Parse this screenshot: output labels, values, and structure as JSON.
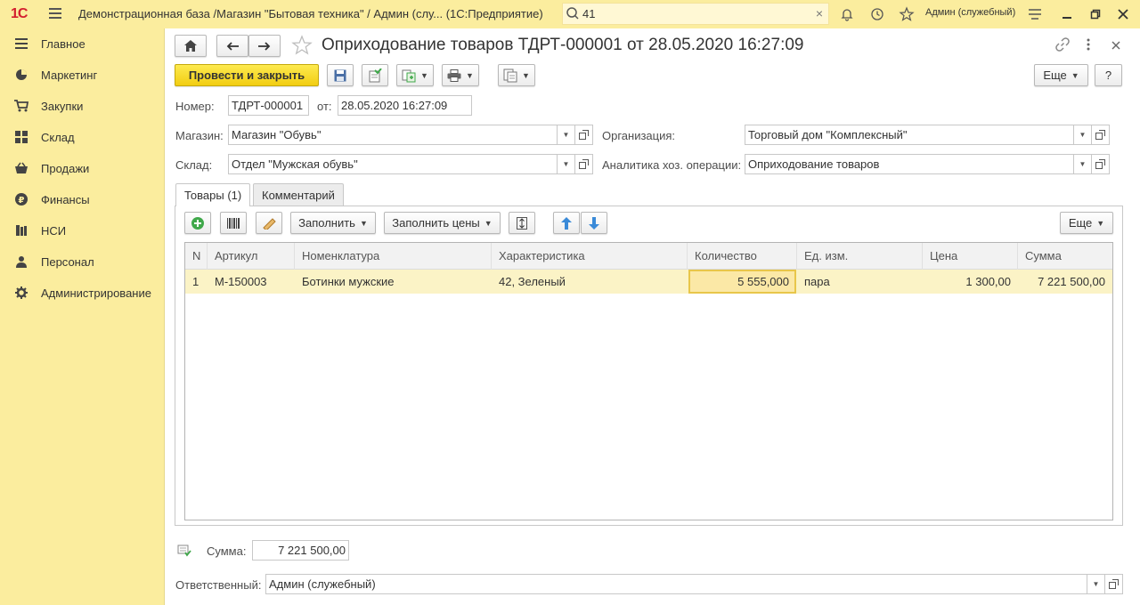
{
  "titlebar": {
    "logo_text": "1С",
    "app_title": "Демонстрационная база /Магазин \"Бытовая техника\" / Админ (слу...  (1С:Предприятие)",
    "search_value": "41",
    "user_name": "Админ (служебный)",
    "icons": [
      "menu-icon",
      "search-icon",
      "clear-icon",
      "bell-icon",
      "history-icon",
      "star-icon",
      "settings-icon",
      "minimize-icon",
      "restore-icon",
      "close-icon"
    ]
  },
  "sidebar": {
    "items": [
      {
        "label": "Главное",
        "icon": "menu-lines-icon"
      },
      {
        "label": "Маркетинг",
        "icon": "pie-chart-icon"
      },
      {
        "label": "Закупки",
        "icon": "cart-icon"
      },
      {
        "label": "Склад",
        "icon": "warehouse-icon"
      },
      {
        "label": "Продажи",
        "icon": "basket-icon"
      },
      {
        "label": "Финансы",
        "icon": "ruble-icon"
      },
      {
        "label": "НСИ",
        "icon": "books-icon"
      },
      {
        "label": "Персонал",
        "icon": "person-icon"
      },
      {
        "label": "Администрирование",
        "icon": "gear-icon"
      }
    ]
  },
  "document": {
    "title": "Оприходование товаров ТДРТ-000001 от 28.05.2020 16:27:09",
    "post_and_close_label": "Провести и закрыть",
    "more_label": "Еще",
    "help_label": "?",
    "number_label": "Номер:",
    "number_value": "ТДРТ-000001",
    "date_label": "от:",
    "date_value": "28.05.2020 16:27:09",
    "store_label": "Магазин:",
    "store_value": "Магазин \"Обувь\"",
    "warehouse_label": "Склад:",
    "warehouse_value": "Отдел \"Мужская обувь\"",
    "org_label": "Организация:",
    "org_value": "Торговый дом \"Комплексный\"",
    "analytics_label": "Аналитика хоз. операции:",
    "analytics_value": "Оприходование товаров"
  },
  "tabs": [
    {
      "label": "Товары (1)",
      "active": true
    },
    {
      "label": "Комментарий",
      "active": false
    }
  ],
  "goods_toolbar": {
    "fill_label": "Заполнить",
    "fill_prices_label": "Заполнить цены",
    "more_label": "Еще"
  },
  "table": {
    "columns": [
      "N",
      "Артикул",
      "Номенклатура",
      "Характеристика",
      "Количество",
      "Ед. изм.",
      "Цена",
      "Сумма"
    ],
    "rows": [
      {
        "n": "1",
        "article": "М-150003",
        "item": "Ботинки мужские",
        "characteristic": "42, Зеленый",
        "quantity": "5 555,000",
        "unit": "пара",
        "price": "1 300,00",
        "sum": "7 221 500,00"
      }
    ]
  },
  "footer": {
    "sum_label": "Сумма:",
    "sum_value": "7 221 500,00",
    "responsible_label": "Ответственный:",
    "responsible_value": "Админ (служебный)"
  },
  "colors": {
    "sidebar_bg": "#fbed9e",
    "primary_button": "#f7d61c",
    "selected_row": "#fbf3c6",
    "current_cell_border": "#e8c64a",
    "add_icon": "#3fa84a",
    "arrow_icon": "#3a8ad8"
  }
}
